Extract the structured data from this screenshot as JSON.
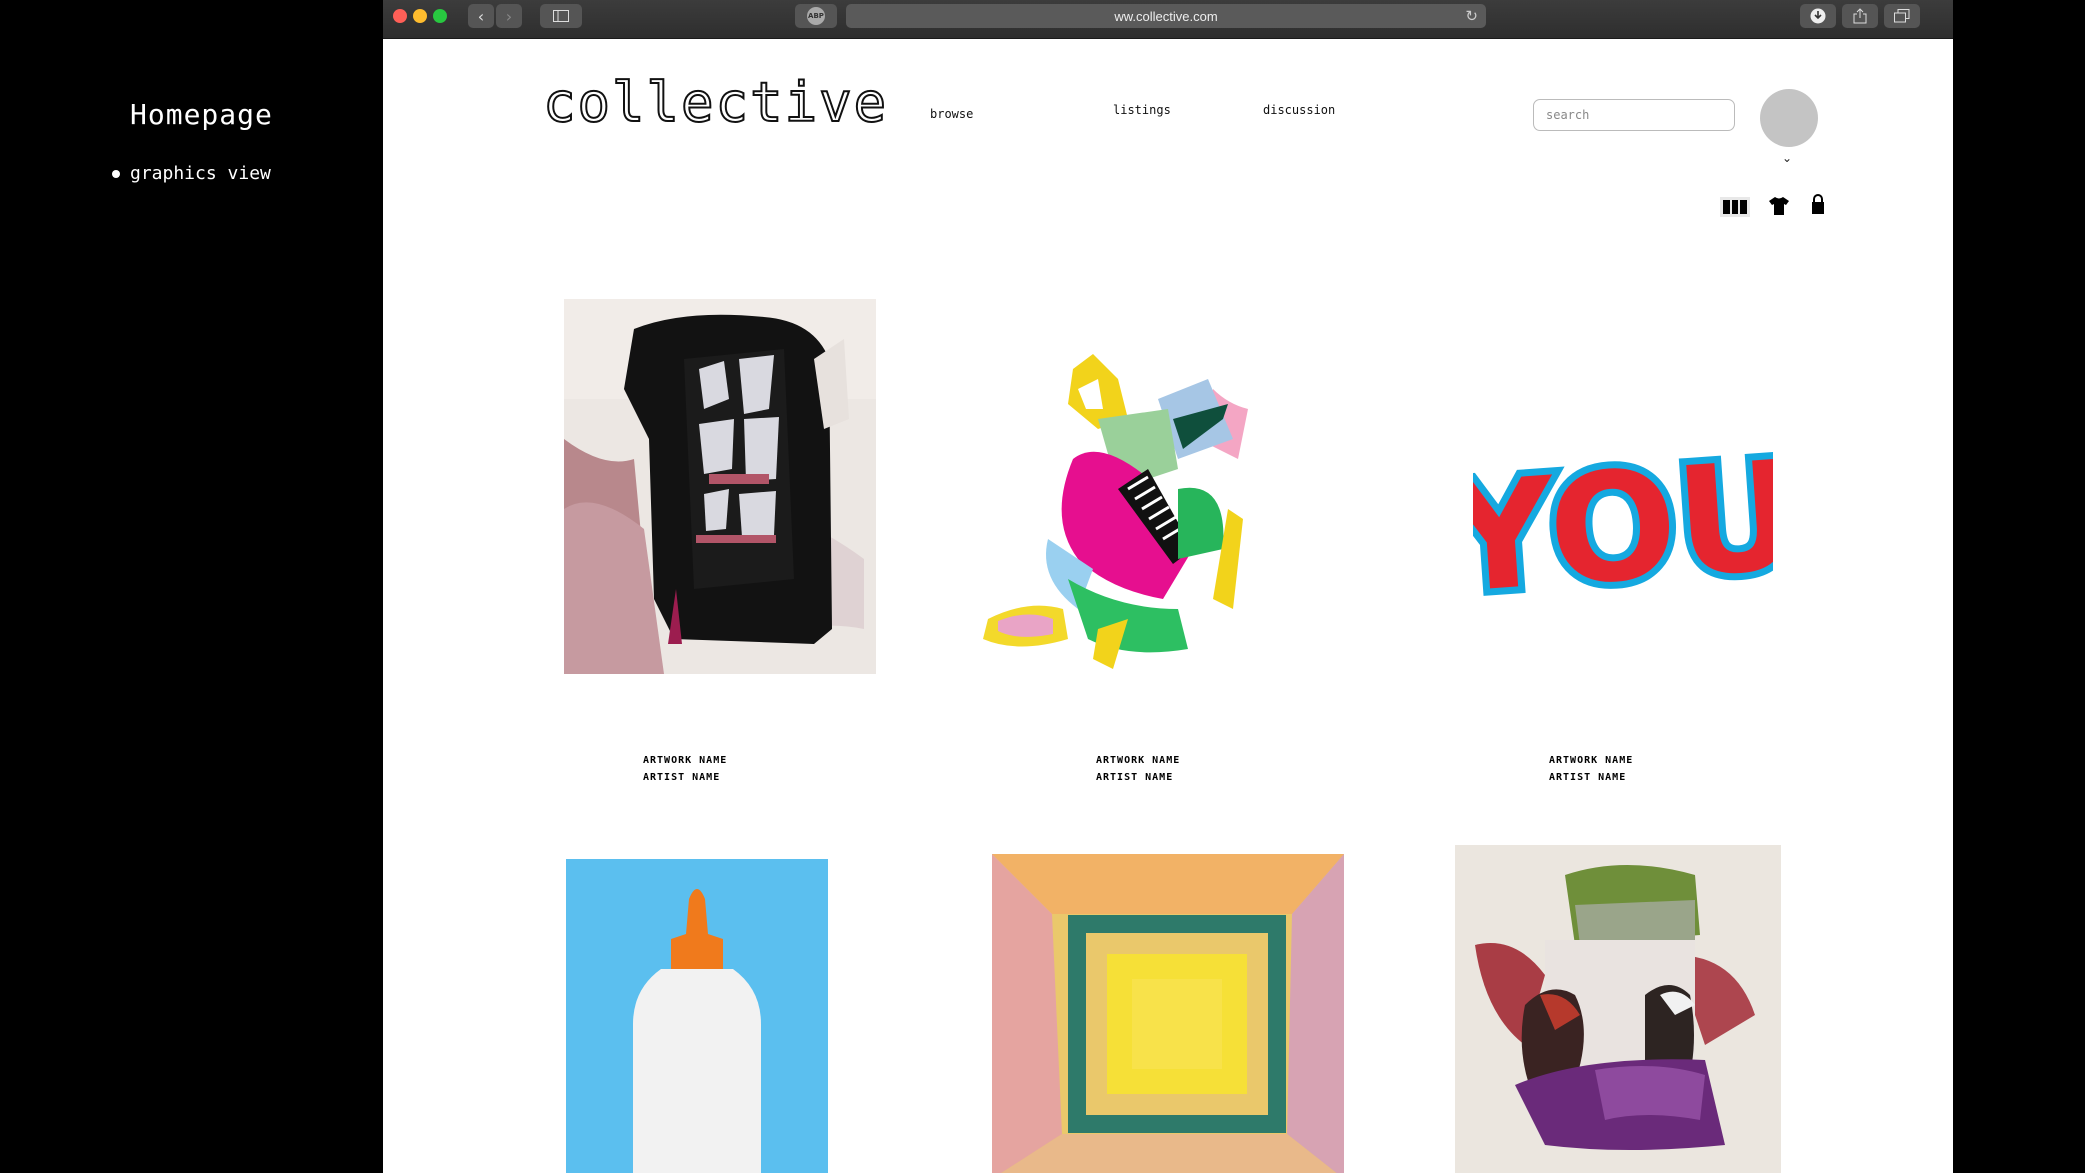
{
  "annotation": {
    "title": "Homepage",
    "item": "graphics view"
  },
  "browser": {
    "url": "ww.collective.com",
    "adblock_label": "ABP"
  },
  "header": {
    "logo": "collective",
    "nav": [
      "browse",
      "listings",
      "discussion"
    ],
    "search_placeholder": "search"
  },
  "view_toggle": {
    "icons": [
      "grid-view-icon",
      "shirt-icon",
      "lock-bag-icon"
    ]
  },
  "artworks": [
    {
      "name": "ARTWORK NAME",
      "artist": "ARTIST NAME"
    },
    {
      "name": "ARTWORK NAME",
      "artist": "ARTIST NAME"
    },
    {
      "name": "ARTWORK NAME",
      "artist": "ARTIST NAME"
    }
  ],
  "artwork_texts": {
    "you_text": "YOU"
  },
  "colors": {
    "background": "#000000",
    "page": "#ffffff",
    "avatar": "#c4c4c4",
    "glue_background": "#5bbfef",
    "glue_cap": "#f07a1c"
  }
}
